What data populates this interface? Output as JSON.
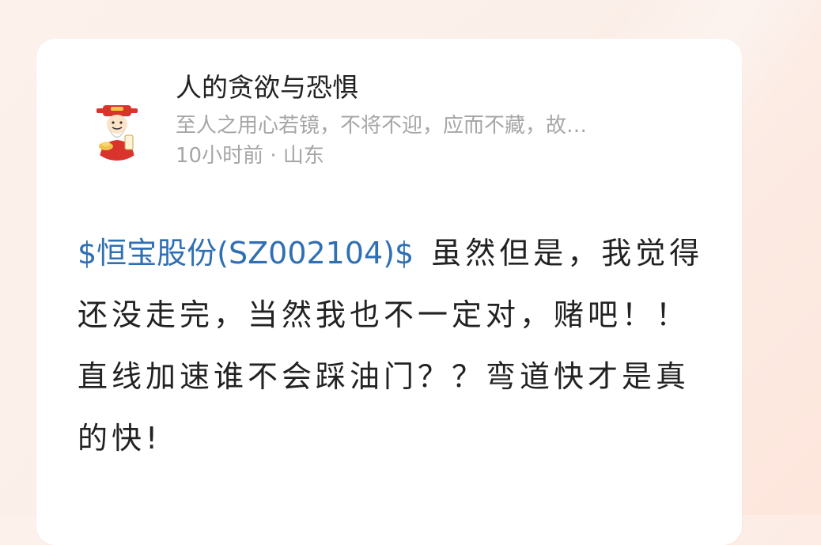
{
  "post": {
    "author": {
      "name": "人的贪欲与恐惧",
      "bio": "至人之用心若镜，不将不迎，应而不藏，故…",
      "avatar_icon": "caishen-avatar-icon"
    },
    "meta": "10小时前 · 山东",
    "stock_tag": "$恒宝股份(SZ002104)$",
    "content": "虽然但是，我觉得还没走完，当然我也不一定对，赌吧！！直线加速谁不会踩油门？？弯道快才是真的快!"
  },
  "colors": {
    "link": "#2f6fb3",
    "text": "#222222",
    "muted": "#a6a6a6",
    "background": "#fbefe9"
  }
}
